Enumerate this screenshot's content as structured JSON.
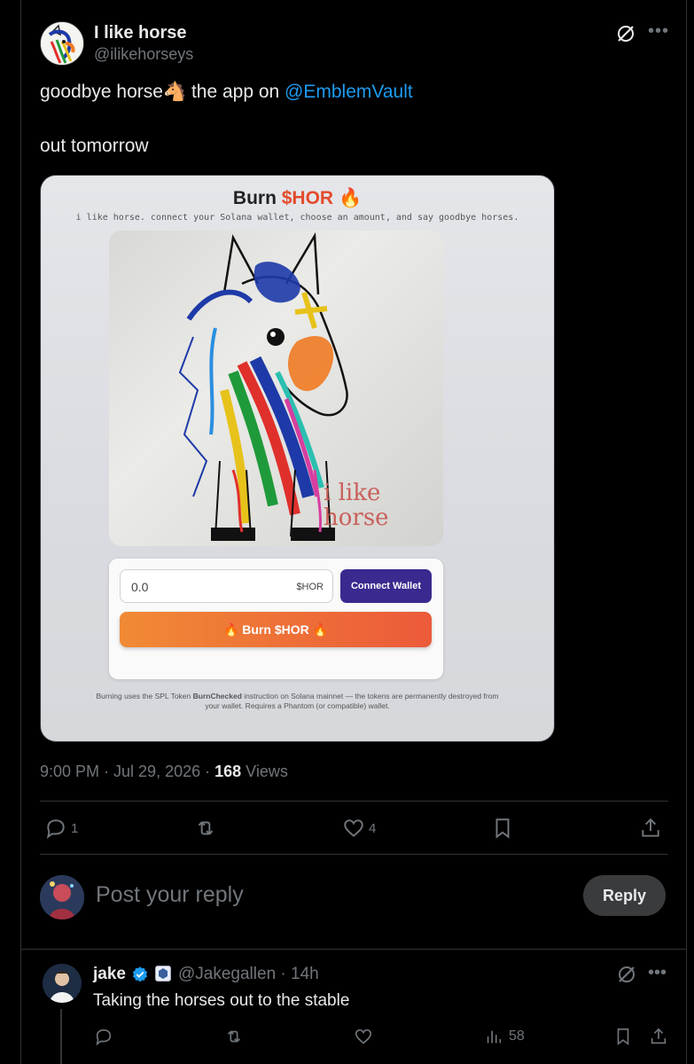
{
  "post": {
    "display_name": "I like horse",
    "handle": "@ilikehorseys",
    "text_before_emoji": "goodbye horse",
    "emoji": "🐴",
    "text_after_emoji": " the app on ",
    "mention": "@EmblemVault",
    "text_line2": "out tomorrow",
    "time": "9:00 PM · Jul 29, 2026 · ",
    "views_count": "168",
    "views_label": " Views"
  },
  "media": {
    "title_prefix": "Burn ",
    "title_token": "$HOR",
    "title_emoji": "🔥",
    "subtitle": "i like horse. connect your Solana wallet, choose an amount, and say goodbye horses.",
    "art_caption_line1": "i like",
    "art_caption_line2": "horse",
    "amount_value": "0.0",
    "amount_unit": "$HOR",
    "connect_label": "Connect Wallet",
    "burn_label": "🔥 Burn $HOR 🔥",
    "fine_print_1": "Burning uses the SPL Token ",
    "fine_print_bold": "BurnChecked",
    "fine_print_2": " instruction on Solana mainnet — the tokens are permanently destroyed from your wallet. Requires a Phantom (or compatible) wallet."
  },
  "actions": {
    "replies": "1",
    "reposts": "",
    "likes": "4"
  },
  "reply_box": {
    "placeholder": "Post your reply",
    "button": "Reply"
  },
  "reply": {
    "name": "jake",
    "handle_time": "@Jakegallen · 14h",
    "text": "Taking the horses out to the stable",
    "views": "58"
  },
  "colors": {
    "background": "#000000",
    "text": "#e7e9ea",
    "muted": "#71767b",
    "link": "#1d9bf0",
    "border": "#2f3336",
    "connect_button": "#3a2a8f",
    "burn_gradient_start": "#f08a35",
    "burn_gradient_end": "#ec5a3a"
  },
  "icons": [
    "grok-icon",
    "more-icon",
    "reply-icon",
    "repost-icon",
    "like-icon",
    "bookmark-icon",
    "share-icon",
    "views-icon",
    "verified-icon"
  ]
}
